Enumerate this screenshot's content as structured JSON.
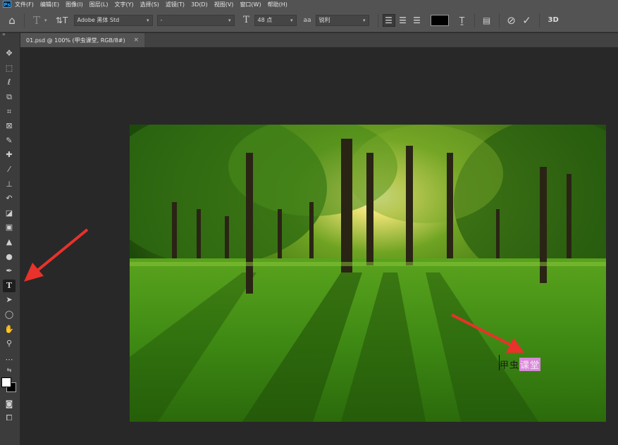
{
  "app": {
    "logo": "Ps"
  },
  "menubar": {
    "items": [
      "文件(F)",
      "编辑(E)",
      "图像(I)",
      "图层(L)",
      "文字(Y)",
      "选择(S)",
      "滤镜(T)",
      "3D(D)",
      "视图(V)",
      "窗口(W)",
      "帮助(H)"
    ]
  },
  "options": {
    "font_family": "Adobe 黑体 Std",
    "font_style": "-",
    "font_size": "48 点",
    "antialias_icon": "aa",
    "antialias": "锐利",
    "text_color": "#000000",
    "three_d_label": "3D"
  },
  "document": {
    "tab_title": "01.psd @ 100% (甲虫课堂, RGB/8#)",
    "text_plain": "甲虫",
    "text_selected": "课堂"
  },
  "colors": {
    "accent_arrow": "#e8322b",
    "selection": "#d88ad8"
  },
  "icons": {
    "home": "home-icon",
    "type": "type-icon",
    "orientation": "text-orientation-icon",
    "move": "move-icon",
    "marquee": "marquee-icon",
    "lasso": "lasso-icon",
    "object_select": "object-select-icon",
    "crop": "crop-icon",
    "frame": "frame-icon",
    "eyedropper": "eyedropper-icon",
    "healing": "healing-brush-icon",
    "brush": "brush-icon",
    "stamp": "clone-stamp-icon",
    "history_brush": "history-brush-icon",
    "eraser": "eraser-icon",
    "gradient": "gradient-icon",
    "blur": "blur-icon",
    "dodge": "dodge-icon",
    "pen": "pen-icon",
    "path_select": "path-selection-icon",
    "ellipse": "ellipse-icon",
    "hand": "hand-icon",
    "zoom": "zoom-icon",
    "more": "more-tools-icon",
    "quick_mask": "quick-mask-icon",
    "screen_mode": "screen-mode-icon"
  }
}
